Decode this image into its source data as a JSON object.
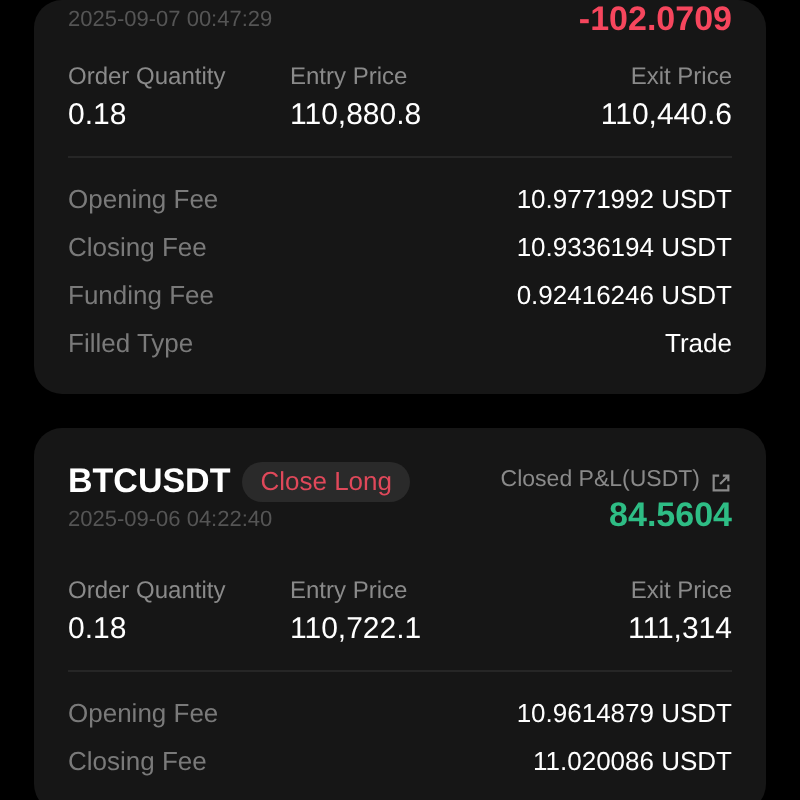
{
  "trades": [
    {
      "timestamp": "2025-09-07 00:47:29",
      "pnl": "-102.0709",
      "color": "#f6465d",
      "columns": [
        {
          "label": "Order Quantity",
          "value": "0.18"
        },
        {
          "label": "Entry Price",
          "value": "110,880.8"
        },
        {
          "label": "Exit Price",
          "value": "110,440.6"
        }
      ],
      "fees": [
        {
          "label": "Opening Fee",
          "value": "10.9771992 USDT"
        },
        {
          "label": "Closing Fee",
          "value": "10.9336194 USDT"
        },
        {
          "label": "Funding Fee",
          "value": "0.92416246 USDT"
        },
        {
          "label": "Filled Type",
          "value": "Trade"
        }
      ]
    },
    {
      "symbol": "BTCUSDT",
      "side": "Close Long",
      "timestamp": "2025-09-06 04:22:40",
      "pnl_label": "Closed P&L(USDT)",
      "pnl": "84.5604",
      "color": "#2ebd85",
      "columns": [
        {
          "label": "Order Quantity",
          "value": "0.18"
        },
        {
          "label": "Entry Price",
          "value": "110,722.1"
        },
        {
          "label": "Exit Price",
          "value": "111,314"
        }
      ],
      "fees": [
        {
          "label": "Opening Fee",
          "value": "10.9614879 USDT"
        },
        {
          "label": "Closing Fee",
          "value": "11.020086 USDT"
        }
      ]
    }
  ]
}
